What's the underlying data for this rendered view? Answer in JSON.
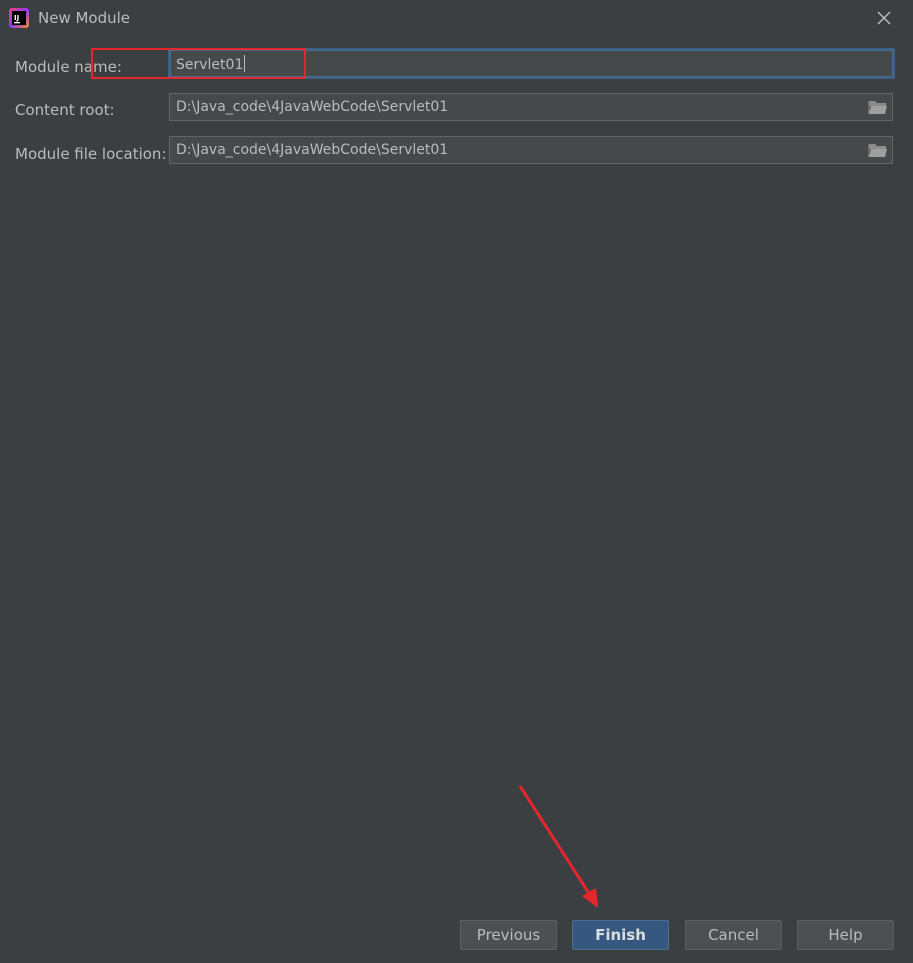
{
  "window": {
    "title": "New Module",
    "app_icon": "intellij-icon",
    "close_icon": "close-icon"
  },
  "form": {
    "module_name": {
      "label": "Module name:",
      "value": "Servlet01"
    },
    "content_root": {
      "label": "Content root:",
      "value": "D:\\Java_code\\4JavaWebCode\\Servlet01",
      "browse_icon": "folder-open-icon"
    },
    "module_file_location": {
      "label": "Module file location:",
      "value": "D:\\Java_code\\4JavaWebCode\\Servlet01",
      "browse_icon": "folder-open-icon"
    }
  },
  "buttons": {
    "previous": "Previous",
    "finish": "Finish",
    "cancel": "Cancel",
    "help": "Help"
  },
  "colors": {
    "background": "#3c3f41",
    "field_background": "#45494a",
    "primary_button": "#365880",
    "annotation_red": "#e5262c"
  }
}
